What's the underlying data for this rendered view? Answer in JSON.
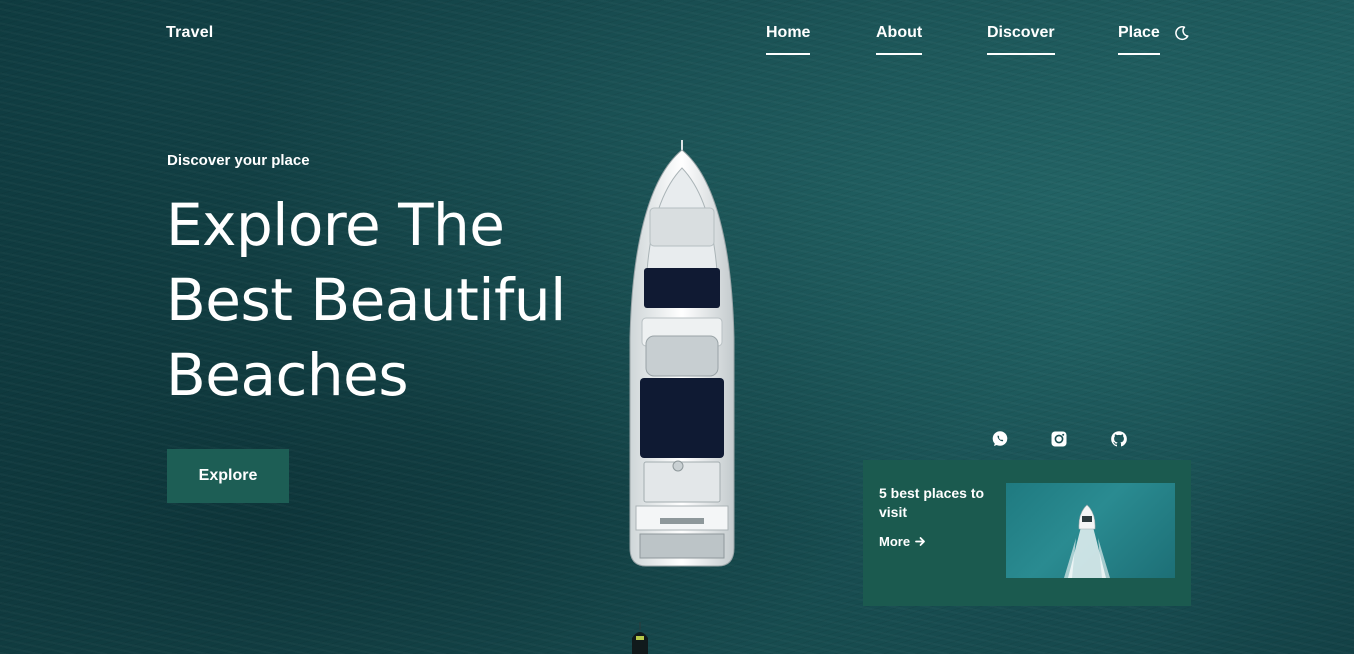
{
  "brand": {
    "name": "Travel"
  },
  "nav": {
    "items": [
      {
        "label": "Home"
      },
      {
        "label": "About"
      },
      {
        "label": "Discover"
      },
      {
        "label": "Place"
      }
    ],
    "theme_toggle_icon": "moon-icon"
  },
  "hero": {
    "subtitle": "Discover your place",
    "title_lines": [
      "Explore The",
      "Best Beautiful",
      "Beaches"
    ],
    "cta_label": "Explore",
    "background": "aerial photo of yacht on dark teal sea"
  },
  "social": {
    "icons": [
      "whatsapp-icon",
      "instagram-icon",
      "github-icon"
    ]
  },
  "promo_card": {
    "title": "5 best places to visit",
    "more_label": "More",
    "more_icon": "arrow-right-icon"
  },
  "colors": {
    "accent": "#1d5e55",
    "card": "#1b5a4f",
    "sea": "#164a4e",
    "text": "#ffffff"
  }
}
